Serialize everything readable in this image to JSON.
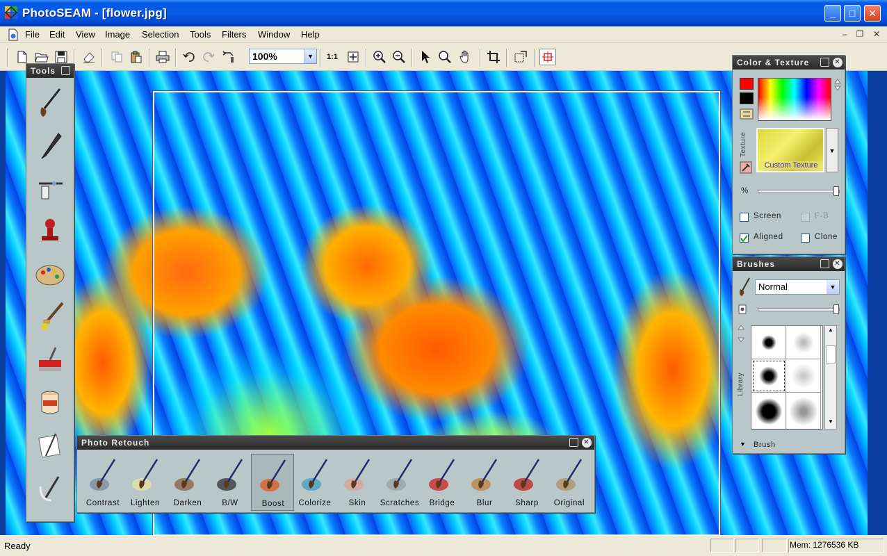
{
  "window": {
    "title": "PhotoSEAM - [flower.jpg]",
    "minimize_label": "_",
    "maximize_label": "□",
    "close_label": "✕"
  },
  "menu": {
    "items": [
      "File",
      "Edit",
      "View",
      "Image",
      "Selection",
      "Tools",
      "Filters",
      "Window",
      "Help"
    ],
    "mdi_minimize": "–",
    "mdi_restore": "❐",
    "mdi_close": "✕"
  },
  "toolbar": {
    "zoom_value": "100%",
    "ratio_label": "1:1",
    "dropdown_arrow": "▼",
    "icons": [
      "new-file-icon",
      "open-folder-icon",
      "save-icon",
      "eraser-icon",
      "copy-icon",
      "paste-icon",
      "print-icon",
      "undo-icon",
      "redo-icon",
      "revert-icon",
      "zoom-in-icon",
      "zoom-out-icon",
      "pointer-icon",
      "magnifier-icon",
      "hand-icon",
      "crop-icon",
      "resize-icon",
      "seam-icon"
    ]
  },
  "tools_panel": {
    "title": "Tools",
    "tools": [
      "paint-brush-tool",
      "pencil-tool",
      "airbrush-tool",
      "clone-stamp-tool",
      "palette-tool",
      "smudge-tool",
      "fill-tool",
      "bucket-tool",
      "picture-frame-tool",
      "rotate-tool"
    ]
  },
  "retouch_panel": {
    "title": "Photo Retouch",
    "items": [
      {
        "label": "Contrast",
        "selected": false,
        "color": "#7a8aa0"
      },
      {
        "label": "Lighten",
        "selected": false,
        "color": "#e8e4a0"
      },
      {
        "label": "Darken",
        "selected": false,
        "color": "#8a6040"
      },
      {
        "label": "B/W",
        "selected": false,
        "color": "#333333"
      },
      {
        "label": "Boost",
        "selected": true,
        "color": "#e05a20"
      },
      {
        "label": "Colorize",
        "selected": false,
        "color": "#40a0c0"
      },
      {
        "label": "Skin",
        "selected": false,
        "color": "#e0a090"
      },
      {
        "label": "Scratches",
        "selected": false,
        "color": "#9aa0a8"
      },
      {
        "label": "Bridge",
        "selected": false,
        "color": "#d02020"
      },
      {
        "label": "Blur",
        "selected": false,
        "color": "#c08040"
      },
      {
        "label": "Sharp",
        "selected": false,
        "color": "#c02020"
      },
      {
        "label": "Original",
        "selected": false,
        "color": "#b09060"
      }
    ]
  },
  "color_panel": {
    "title": "Color & Texture",
    "foreground_color": "#ff0000",
    "background_color": "#000000",
    "texture_vlabel": "Texture",
    "texture_name": "Custom Texture",
    "percent_label": "%",
    "opacity_value": 100,
    "checkboxes": [
      {
        "label": "Screen",
        "checked": false,
        "enabled": true
      },
      {
        "label": "F-B",
        "checked": false,
        "enabled": false
      },
      {
        "label": "Aligned",
        "checked": true,
        "enabled": true
      },
      {
        "label": "Clone",
        "checked": false,
        "enabled": true
      }
    ]
  },
  "brush_panel": {
    "title": "Brushes",
    "mode": "Normal",
    "library_vlabel": "Library",
    "footer_label": "Brush",
    "size_value": 100
  },
  "status": {
    "text": "Ready",
    "memory": "Mem: 1276536 KB"
  }
}
